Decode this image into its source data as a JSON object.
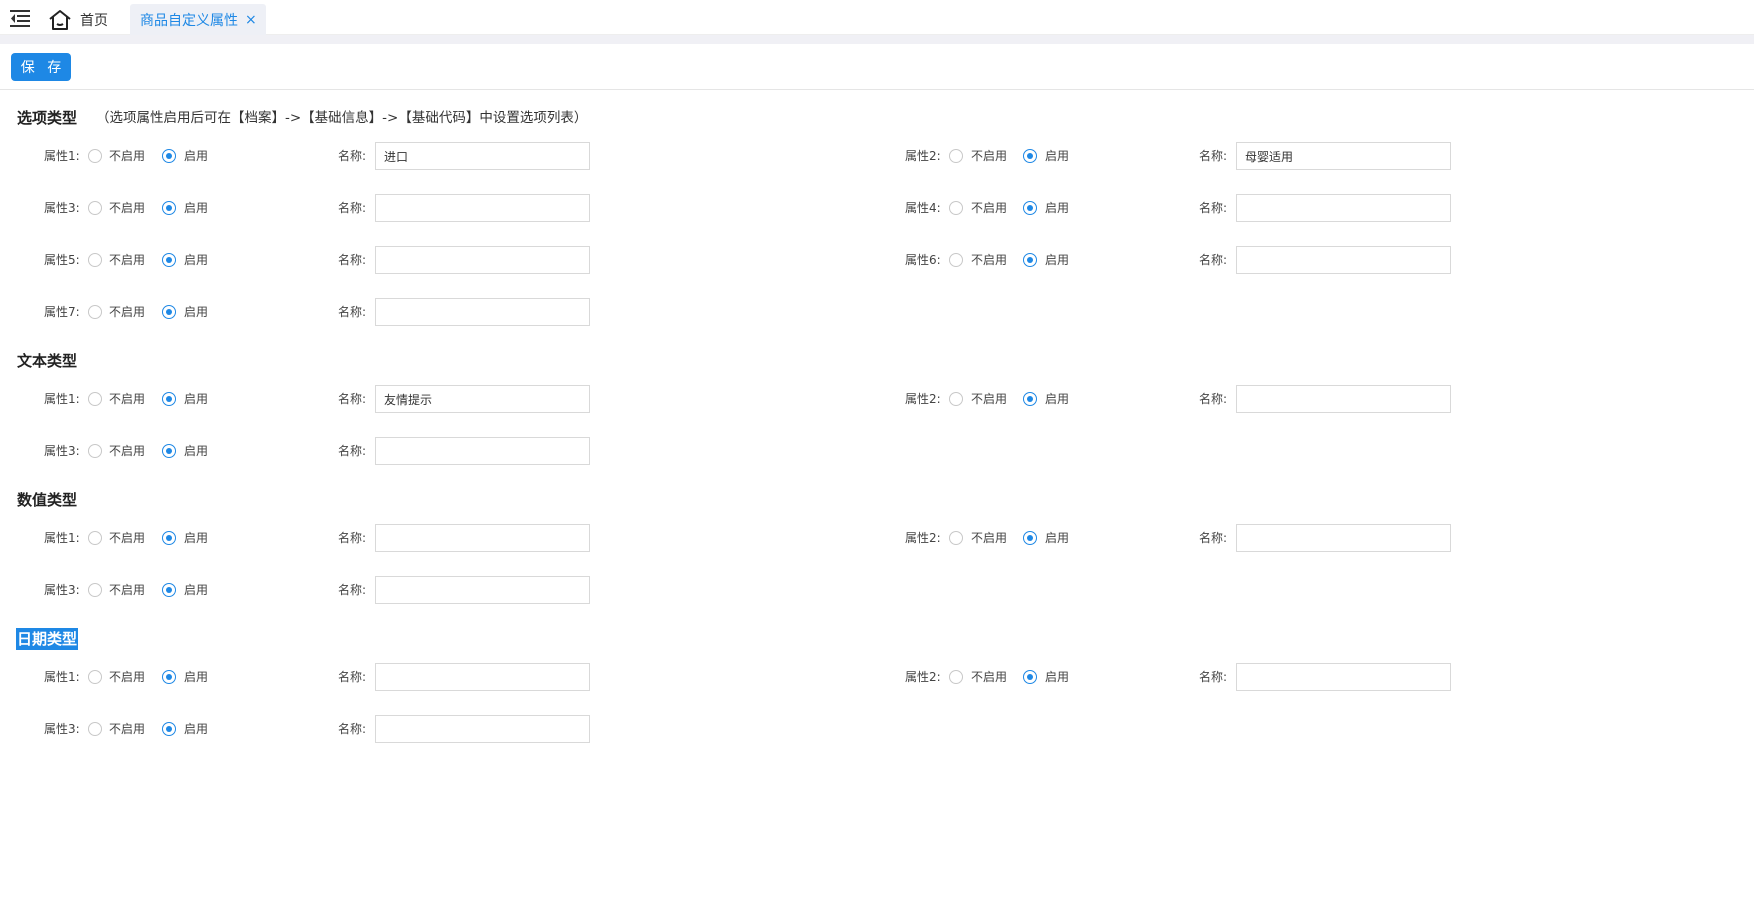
{
  "tabs": {
    "home_label": "首页",
    "active_label": "商品自定义属性",
    "close_glyph": "×"
  },
  "toolbar": {
    "save_label": "保 存"
  },
  "radio_labels": {
    "off": "不启用",
    "on": "启用"
  },
  "name_label": "名称:",
  "sections": {
    "option": {
      "title": "选项类型",
      "hint": "（选项属性启用后可在【档案】->【基础信息】->【基础代码】中设置选项列表）",
      "props": [
        {
          "label": "属性1:",
          "enabled": true,
          "name": "进口"
        },
        {
          "label": "属性2:",
          "enabled": true,
          "name": "母婴适用"
        },
        {
          "label": "属性3:",
          "enabled": true,
          "name": ""
        },
        {
          "label": "属性4:",
          "enabled": true,
          "name": ""
        },
        {
          "label": "属性5:",
          "enabled": true,
          "name": ""
        },
        {
          "label": "属性6:",
          "enabled": true,
          "name": ""
        },
        {
          "label": "属性7:",
          "enabled": true,
          "name": ""
        }
      ]
    },
    "text": {
      "title": "文本类型",
      "props": [
        {
          "label": "属性1:",
          "enabled": true,
          "name": "友情提示"
        },
        {
          "label": "属性2:",
          "enabled": true,
          "name": ""
        },
        {
          "label": "属性3:",
          "enabled": true,
          "name": ""
        }
      ]
    },
    "number": {
      "title": "数值类型",
      "props": [
        {
          "label": "属性1:",
          "enabled": true,
          "name": ""
        },
        {
          "label": "属性2:",
          "enabled": true,
          "name": ""
        },
        {
          "label": "属性3:",
          "enabled": true,
          "name": ""
        }
      ]
    },
    "date": {
      "title": "日期类型",
      "props": [
        {
          "label": "属性1:",
          "enabled": true,
          "name": ""
        },
        {
          "label": "属性2:",
          "enabled": true,
          "name": ""
        },
        {
          "label": "属性3:",
          "enabled": true,
          "name": ""
        }
      ]
    }
  },
  "colors": {
    "accent": "#1e88e5",
    "strip": "#f0f0f5"
  }
}
